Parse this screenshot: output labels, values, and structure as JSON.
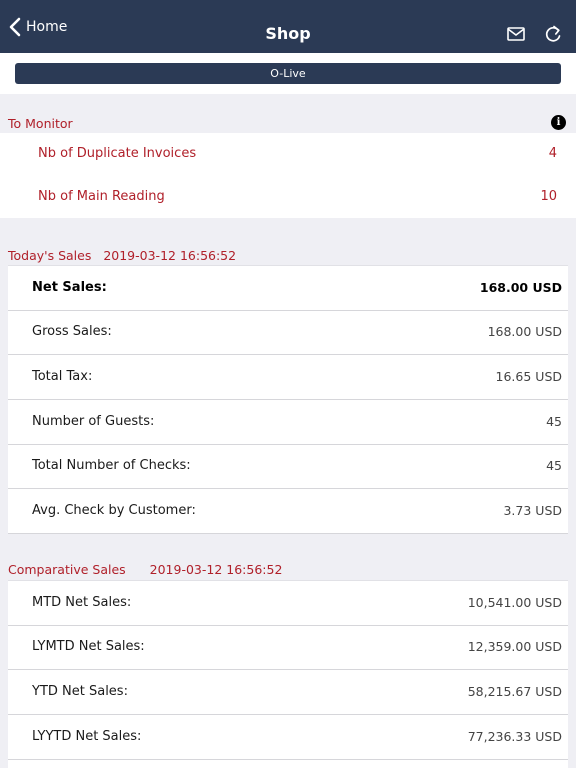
{
  "nav": {
    "back_label": "Home",
    "title": "Shop",
    "bar_color": "#2b3a55",
    "icons": [
      "chevron-left-icon",
      "mail-icon",
      "refresh-icon"
    ]
  },
  "olive_button": {
    "label": "O-Live"
  },
  "monitor": {
    "title": "To Monitor",
    "info_glyph": "i",
    "rows": [
      {
        "label": "Nb of Duplicate Invoices",
        "value": "4"
      },
      {
        "label": "Nb of Main Reading",
        "value": "10"
      }
    ]
  },
  "today": {
    "title": "Today's Sales",
    "timestamp": "2019-03-12 16:56:52",
    "rows": [
      {
        "label": "Net Sales:",
        "value": "168.00 USD"
      },
      {
        "label": "Gross Sales:",
        "value": "168.00 USD"
      },
      {
        "label": "Total Tax:",
        "value": "16.65 USD"
      },
      {
        "label": "Number of Guests:",
        "value": "45"
      },
      {
        "label": "Total Number of Checks:",
        "value": "45"
      },
      {
        "label": "Avg. Check by Customer:",
        "value": "3.73 USD"
      }
    ]
  },
  "comparative": {
    "title": "Comparative Sales",
    "timestamp": "2019-03-12 16:56:52",
    "rows": [
      {
        "label": "MTD Net Sales:",
        "value": "10,541.00 USD"
      },
      {
        "label": "LYMTD Net Sales:",
        "value": "12,359.00 USD"
      },
      {
        "label": "YTD Net Sales:",
        "value": "58,215.67 USD"
      },
      {
        "label": "LYYTD Net Sales:",
        "value": "77,236.33 USD"
      }
    ]
  },
  "colors": {
    "accent": "#b0202a",
    "navbar": "#2b3a55",
    "background": "#efeff4"
  }
}
